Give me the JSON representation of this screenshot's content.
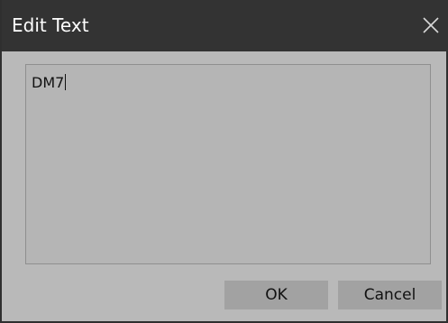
{
  "dialog": {
    "title": "Edit Text",
    "close_icon": "close-icon",
    "text_value": "DM7",
    "ok_label": "OK",
    "cancel_label": "Cancel"
  },
  "colors": {
    "titlebar": "#333333",
    "body": "#b9b9b9",
    "button": "#a2a2a2"
  }
}
